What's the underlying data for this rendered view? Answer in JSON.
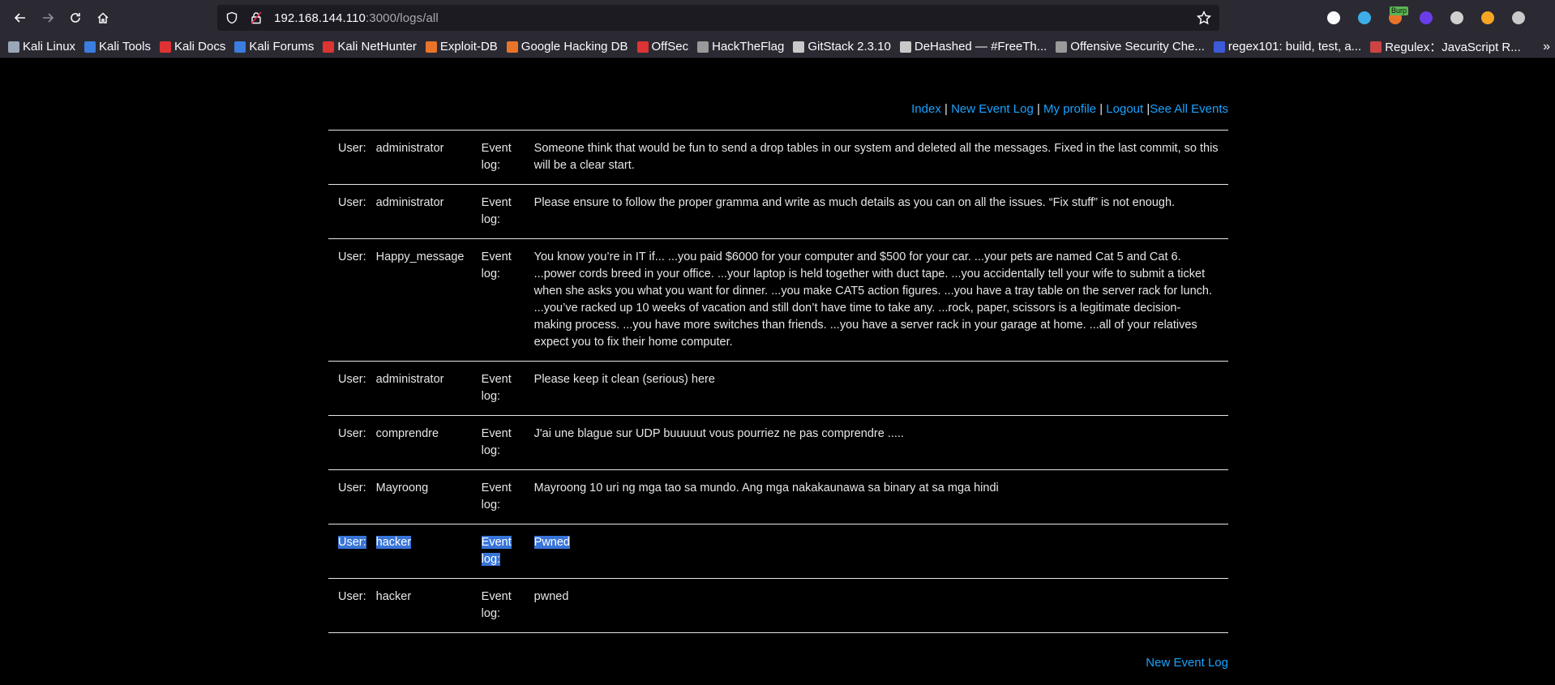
{
  "browser": {
    "url_host": "192.168.144.110",
    "url_path": ":3000/logs/all",
    "extensions": [
      {
        "name": "pocket-icon",
        "color": "#fbfbfe"
      },
      {
        "name": "download-icon",
        "color": "#3daee9"
      },
      {
        "name": "burp-icon",
        "color": "#e8742a",
        "tag": "Burp"
      },
      {
        "name": "extension-purple-icon",
        "color": "#6a3de8"
      },
      {
        "name": "extension-gear-icon",
        "color": "#d0d0d0"
      },
      {
        "name": "extension-orange-icon",
        "color": "#f5a623"
      },
      {
        "name": "extension-wappalyzer-icon",
        "color": "#c9c9c9"
      }
    ]
  },
  "bookmarks": [
    {
      "label": "Kali Linux",
      "icon": "kali-icon",
      "color": "#9aa7b8"
    },
    {
      "label": "Kali Tools",
      "icon": "kali-tools-icon",
      "color": "#3b7de0"
    },
    {
      "label": "Kali Docs",
      "icon": "kali-docs-icon",
      "color": "#d33"
    },
    {
      "label": "Kali Forums",
      "icon": "kali-forums-icon",
      "color": "#3b7de0"
    },
    {
      "label": "Kali NetHunter",
      "icon": "nethunter-icon",
      "color": "#d33"
    },
    {
      "label": "Exploit-DB",
      "icon": "exploitdb-icon",
      "color": "#e8742a"
    },
    {
      "label": "Google Hacking DB",
      "icon": "ghdb-icon",
      "color": "#e8742a"
    },
    {
      "label": "OffSec",
      "icon": "offsec-icon",
      "color": "#d33"
    },
    {
      "label": "HackTheFlag",
      "icon": "flag-icon",
      "color": "#9a9a9a"
    },
    {
      "label": "GitStack 2.3.10",
      "icon": "globe-icon",
      "color": "#c9c9c9"
    },
    {
      "label": "DeHashed — #FreeTh...",
      "icon": "hash-icon",
      "color": "#c9c9c9"
    },
    {
      "label": "Offensive Security Che...",
      "icon": "offsec-cheatsheet-icon",
      "color": "#9a9a9a"
    },
    {
      "label": "regex101: build, test, a...",
      "icon": "regex101-icon",
      "color": "#3b5bdb"
    },
    {
      "label": "Regulex：JavaScript R...",
      "icon": "regulex-icon",
      "color": "#c44"
    }
  ],
  "nav": {
    "index": "Index",
    "new_event_log": "New Event Log",
    "my_profile": "My profile",
    "logout": "Logout",
    "see_all_events": "See All Events",
    "sep1": " | ",
    "sep2": " | ",
    "sep3": " | ",
    "sep4": " |"
  },
  "labels": {
    "user": "User:",
    "event_log": "Event log:"
  },
  "logs": [
    {
      "user": "administrator",
      "message": "Someone think that would be fun to send a drop tables in our system and deleted all the messages. Fixed in the last commit, so this will be a clear start."
    },
    {
      "user": "administrator",
      "message": "Please ensure to follow the proper gramma and write as much details as you can on all the issues. “Fix stuff” is not enough."
    },
    {
      "user": "Happy_message",
      "message": "You know you’re in IT if... ...you paid $6000 for your computer and $500 for your car. ...your pets are named Cat 5 and Cat 6. ...power cords breed in your office. ...your laptop is held together with duct tape. ...you accidentally tell your wife to submit a ticket when she asks you what you want for dinner. ...you make CAT5 action figures. ...you have a tray table on the server rack for lunch. ...you’ve racked up 10 weeks of vacation and still don’t have time to take any. ...rock, paper, scissors is a legitimate decision-making process. ...you have more switches than friends. ...you have a server rack in your garage at home. ...all of your relatives expect you to fix their home computer."
    },
    {
      "user": "administrator",
      "message": "Please keep it clean (serious) here"
    },
    {
      "user": "comprendre",
      "message": "J'ai une blague sur UDP buuuuut vous pourriez ne pas comprendre ....."
    },
    {
      "user": "Mayroong",
      "message": "Mayroong 10 uri ng mga tao sa mundo. Ang mga nakakaunawa sa binary at sa mga hindi"
    },
    {
      "user": "hacker",
      "message": "Pwned"
    },
    {
      "user": "hacker",
      "message": "pwned"
    }
  ],
  "bottom": {
    "new_event_log": "New Event Log"
  }
}
